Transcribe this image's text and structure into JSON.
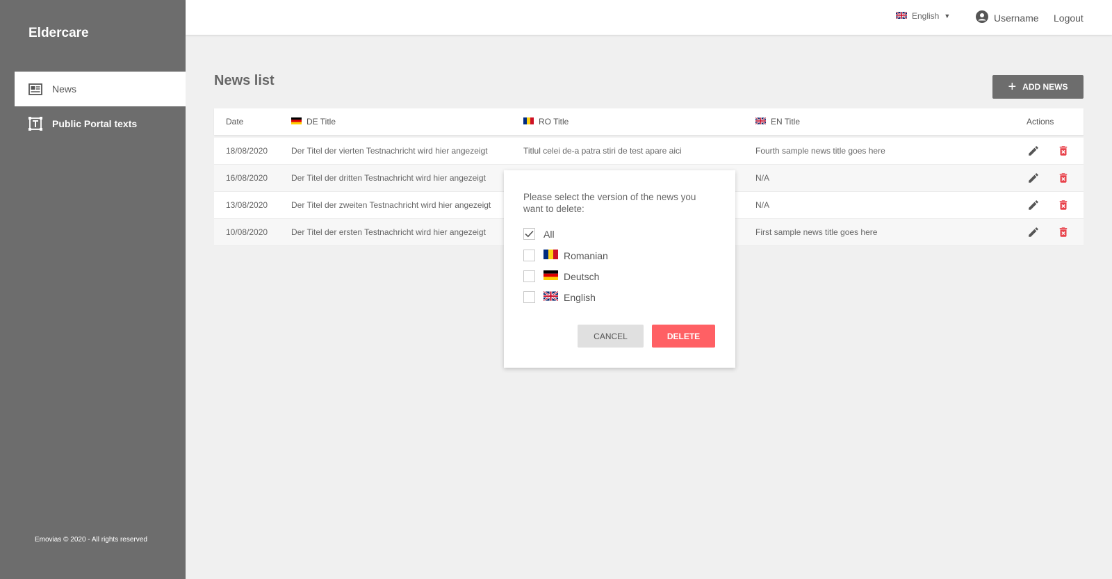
{
  "app": {
    "brand": "Eldercare"
  },
  "sidebar": {
    "items": [
      {
        "label": "News",
        "icon": "newspaper-icon"
      },
      {
        "label": "Public Portal texts",
        "icon": "text-box-icon"
      }
    ],
    "footer": "Emovias © 2020 - All rights reserved"
  },
  "topbar": {
    "language": "English",
    "username": "Username",
    "logout": "Logout"
  },
  "page": {
    "title": "News list",
    "add_button": "ADD NEWS"
  },
  "table": {
    "headers": {
      "date": "Date",
      "de": "DE Title",
      "ro": "RO Title",
      "en": "EN Title",
      "actions": "Actions"
    },
    "rows": [
      {
        "date": "18/08/2020",
        "de": "Der Titel der vierten Testnachricht wird hier angezeigt",
        "ro": "Titlul celei de-a patra stiri de test apare aici",
        "en": "Fourth sample news title goes here"
      },
      {
        "date": "16/08/2020",
        "de": "Der Titel der dritten Testnachricht wird hier angezeigt",
        "ro": "",
        "en": "N/A"
      },
      {
        "date": "13/08/2020",
        "de": "Der Titel der zweiten Testnachricht wird hier angezeigt",
        "ro": "",
        "en": "N/A"
      },
      {
        "date": "10/08/2020",
        "de": "Der Titel der ersten Testnachricht wird hier angezeigt",
        "ro": "",
        "en": "First sample news title goes here"
      }
    ]
  },
  "modal": {
    "message": "Please select the version of the news you want to delete:",
    "options": [
      {
        "label": "All",
        "checked": true
      },
      {
        "label": "Romanian",
        "checked": false
      },
      {
        "label": "Deutsch",
        "checked": false
      },
      {
        "label": "English",
        "checked": false
      }
    ],
    "cancel": "CANCEL",
    "delete": "DELETE"
  },
  "colors": {
    "sidebar": "#6d6d6d",
    "delete_red": "#ff6064",
    "delete_icon": "#e8414a"
  }
}
